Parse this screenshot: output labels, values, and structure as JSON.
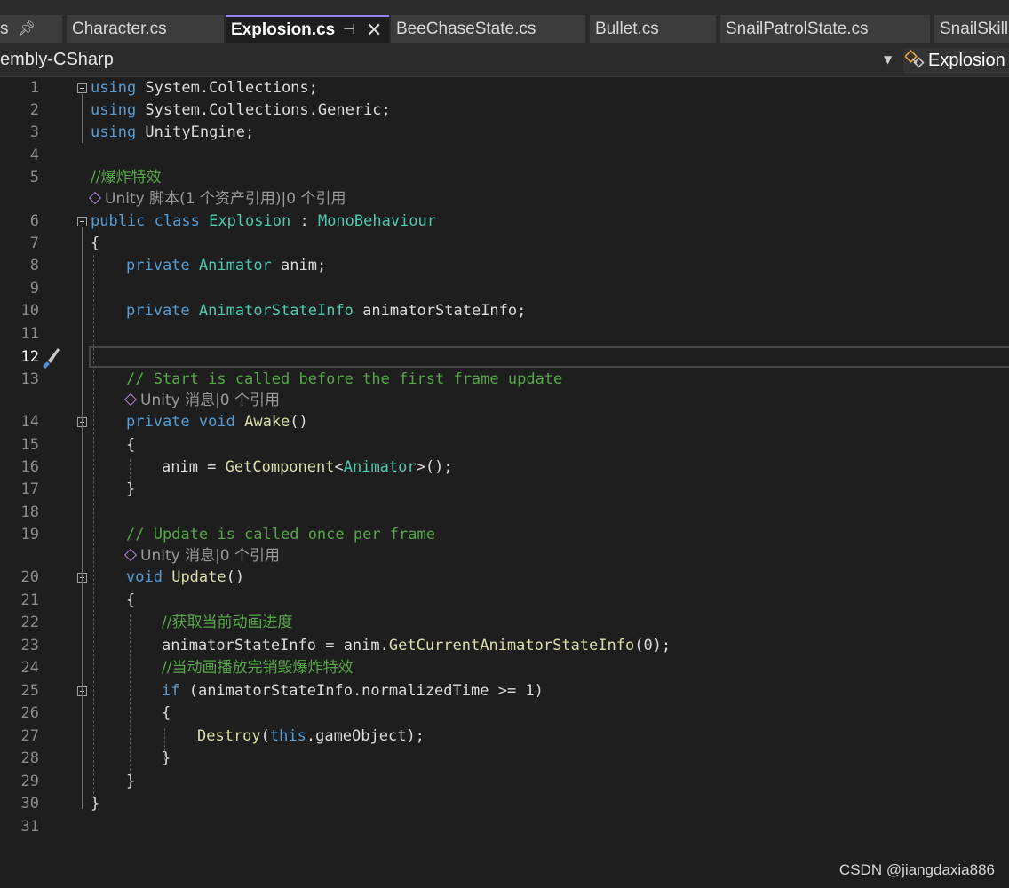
{
  "tabs": [
    {
      "label": "s",
      "pinned": true
    },
    {
      "label": "Character.cs"
    },
    {
      "label": "Explosion.cs",
      "active": true
    },
    {
      "label": "BeeChaseState.cs"
    },
    {
      "label": "Bullet.cs"
    },
    {
      "label": "SnailPatrolState.cs"
    },
    {
      "label": "SnailSkillS"
    }
  ],
  "navbar": {
    "project": "embly-CSharp",
    "member": "Explosion"
  },
  "line_numbers": [
    "1",
    "2",
    "3",
    "4",
    "5",
    "6",
    "7",
    "8",
    "9",
    "10",
    "11",
    "12",
    "13",
    "14",
    "15",
    "16",
    "17",
    "18",
    "19",
    "20",
    "21",
    "22",
    "23",
    "24",
    "25",
    "26",
    "27",
    "28",
    "29",
    "30",
    "31"
  ],
  "current_line": "12",
  "code": {
    "l1": [
      "using",
      " System.Collections;"
    ],
    "l2": [
      "using",
      " System.Collections.Generic;"
    ],
    "l3": [
      "using",
      " UnityEngine;"
    ],
    "l5": "//爆炸特效",
    "l6": [
      "public",
      " ",
      "class",
      " ",
      "Explosion",
      " : ",
      "MonoBehaviour"
    ],
    "l7": "{",
    "l8": [
      "private",
      " ",
      "Animator",
      " anim;"
    ],
    "l10": [
      "private",
      " ",
      "AnimatorStateInfo",
      " animatorStateInfo;"
    ],
    "l13": "// Start is called before the first frame update",
    "l14": [
      "private",
      " ",
      "void",
      " ",
      "Awake",
      "()"
    ],
    "l15": "{",
    "l16": [
      "anim = ",
      "GetComponent",
      "<",
      "Animator",
      ">();"
    ],
    "l17": "}",
    "l19": "// Update is called once per frame",
    "l20": [
      "void",
      " ",
      "Update",
      "()"
    ],
    "l21": "{",
    "l22": "//获取当前动画进度",
    "l23": [
      "animatorStateInfo = anim.",
      "GetCurrentAnimatorStateInfo",
      "(0);"
    ],
    "l24": "//当动画播放完销毁爆炸特效",
    "l25": [
      "if",
      " (animatorStateInfo.normalizedTime >= 1)"
    ],
    "l26": "{",
    "l27": [
      "Destroy",
      "(",
      "this",
      ".gameObject);"
    ],
    "l28": "}",
    "l29": "}",
    "l30": "}"
  },
  "codelens": {
    "class": "Unity 脚本(1 个资产引用)|0 个引用",
    "awake": "Unity 消息|0 个引用",
    "update": "Unity 消息|0 个引用"
  },
  "watermark": "CSDN @jiangdaxia886",
  "colors": {
    "keyword": "#569cd6",
    "type": "#4ec9b0",
    "comment": "#57a64a",
    "method": "#dcdcaa",
    "active_tab_accent": "#9184ee"
  }
}
